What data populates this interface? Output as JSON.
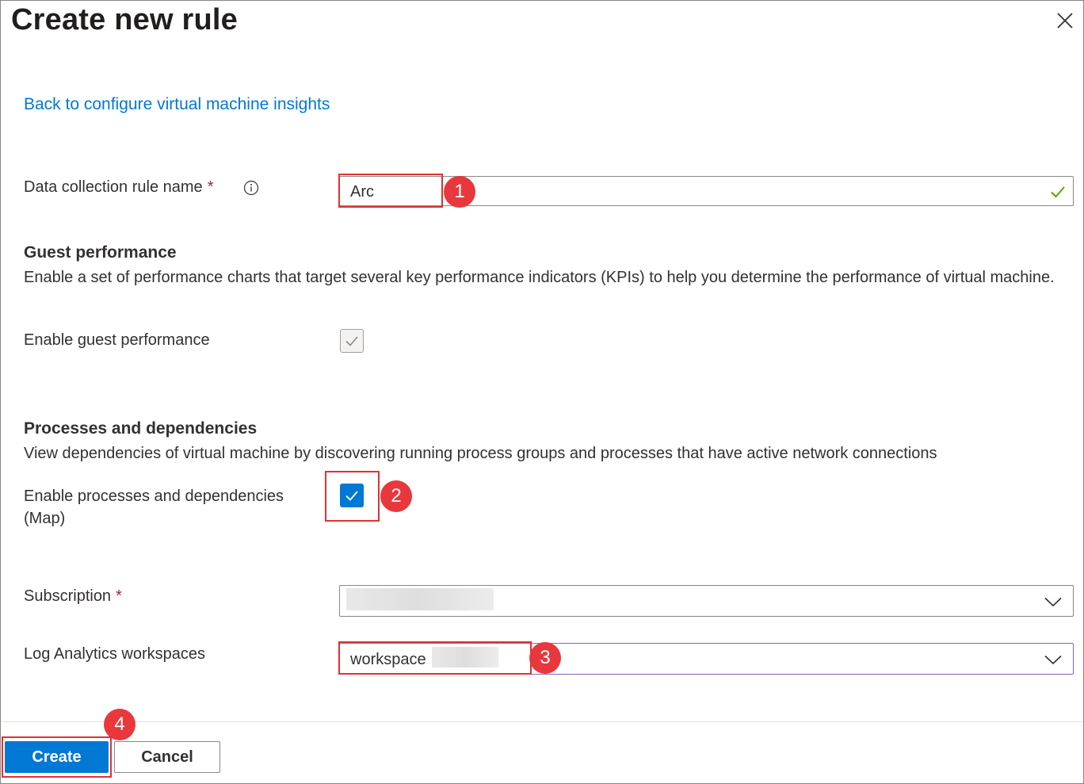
{
  "panel": {
    "title": "Create new rule",
    "back_link": "Back to configure virtual machine insights"
  },
  "dcr_name": {
    "label": "Data collection rule name",
    "required_mark": "*",
    "value": "Arc"
  },
  "guest_performance": {
    "heading": "Guest performance",
    "description": "Enable a set of performance charts that target several key performance indicators (KPIs) to help you determine the performance of virtual machine.",
    "checkbox_label": "Enable guest performance",
    "checked": true,
    "disabled": true
  },
  "processes": {
    "heading": "Processes and dependencies",
    "description": "View dependencies of virtual machine by discovering running process groups and processes that have active network connections",
    "checkbox_label_line1": "Enable processes and dependencies",
    "checkbox_label_line2": "(Map)",
    "checked": true
  },
  "subscription": {
    "label": "Subscription",
    "required_mark": "*",
    "value": ""
  },
  "workspace": {
    "label": "Log Analytics workspaces",
    "value": "workspace"
  },
  "callouts": [
    "1",
    "2",
    "3",
    "4"
  ],
  "footer": {
    "create_label": "Create",
    "cancel_label": "Cancel"
  },
  "icons": {
    "close": "close-icon",
    "info": "info-icon",
    "valid": "checkmark-icon",
    "chevron": "chevron-down-icon"
  },
  "colors": {
    "accent": "#0078d4",
    "callout": "#e8383d",
    "valid": "#57a300",
    "required": "#a4262c"
  }
}
